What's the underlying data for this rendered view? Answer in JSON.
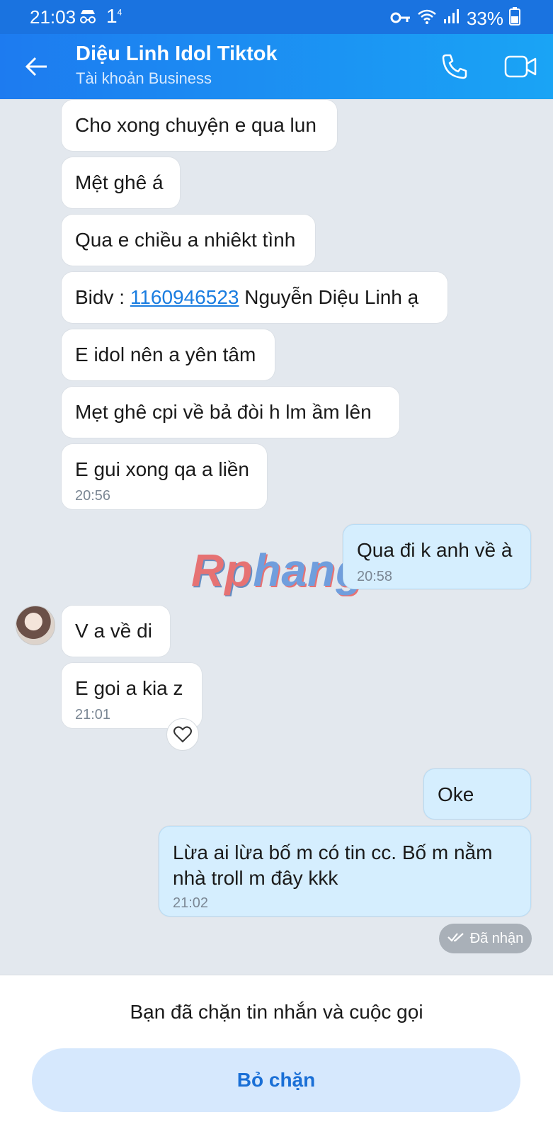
{
  "status_bar": {
    "time": "21:03",
    "network_indicator": "1",
    "network_superscript": "4",
    "battery": "33%"
  },
  "header": {
    "title": "Diệu Linh Idol Tiktok",
    "subtitle": "Tài khoản Business"
  },
  "messages": [
    {
      "text": "Cho xong chuyện e qua lun"
    },
    {
      "text": "Mệt ghê á"
    },
    {
      "text": "Qua e chiều a nhiêkt tình"
    },
    {
      "prefix": "Bidv : ",
      "link": "1160946523",
      "suffix": " Nguyễn Diệu Linh ạ"
    },
    {
      "text": "E idol nên a yên tâm"
    },
    {
      "text": "Mẹt ghê cpi về bả đòi h lm ầm lên"
    },
    {
      "text": "E gui xong qa a liền",
      "time": "20:56"
    },
    {
      "text": "Qua đi k anh về à",
      "time": "20:58"
    },
    {
      "text": "V a về di"
    },
    {
      "text": "E goi a kia z",
      "time": "21:01"
    },
    {
      "text": "Oke"
    },
    {
      "line1": "Lừa ai lừa bố m có tin cc. Bố m nằm",
      "line2": "nhà troll m đây kkk",
      "time": "21:02"
    }
  ],
  "received_label": "Đã nhận",
  "watermark": {
    "part1": "Rp",
    "part2": "hang"
  },
  "bottom": {
    "blocked_text": "Bạn đã chặn tin nhắn và cuộc gọi",
    "unblock_label": "Bỏ chặn"
  }
}
